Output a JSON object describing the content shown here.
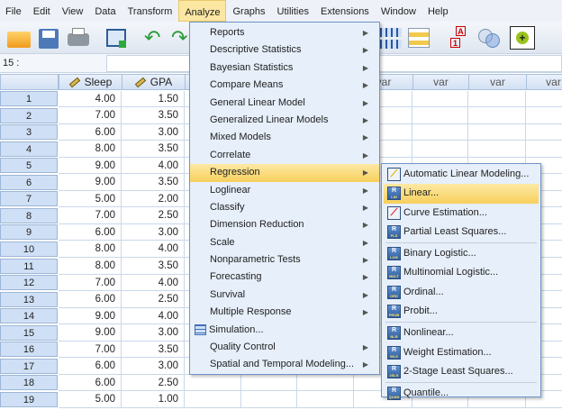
{
  "menubar": [
    "File",
    "Edit",
    "View",
    "Data",
    "Transform",
    "Analyze",
    "Graphs",
    "Utilities",
    "Extensions",
    "Window",
    "Help"
  ],
  "active_menu": "Analyze",
  "cell_ref": "15 :",
  "columns": [
    "Sleep",
    "GPA",
    "var",
    "var",
    "var",
    "var"
  ],
  "rows": [
    [
      "1",
      "4.00",
      "1.50"
    ],
    [
      "2",
      "7.00",
      "3.50"
    ],
    [
      "3",
      "6.00",
      "3.00"
    ],
    [
      "4",
      "8.00",
      "3.50"
    ],
    [
      "5",
      "9.00",
      "4.00"
    ],
    [
      "6",
      "9.00",
      "3.50"
    ],
    [
      "7",
      "5.00",
      "2.00"
    ],
    [
      "8",
      "7.00",
      "2.50"
    ],
    [
      "9",
      "6.00",
      "3.00"
    ],
    [
      "10",
      "8.00",
      "4.00"
    ],
    [
      "11",
      "8.00",
      "3.50"
    ],
    [
      "12",
      "7.00",
      "4.00"
    ],
    [
      "13",
      "6.00",
      "2.50"
    ],
    [
      "14",
      "9.00",
      "4.00"
    ],
    [
      "15",
      "9.00",
      "3.00"
    ],
    [
      "16",
      "7.00",
      "3.50"
    ],
    [
      "17",
      "6.00",
      "3.00"
    ],
    [
      "18",
      "6.00",
      "2.50"
    ],
    [
      "19",
      "5.00",
      "1.00"
    ]
  ],
  "analyze_menu": [
    {
      "label": "Reports",
      "sub": true
    },
    {
      "label": "Descriptive Statistics",
      "sub": true
    },
    {
      "label": "Bayesian Statistics",
      "sub": true
    },
    {
      "label": "Compare Means",
      "sub": true
    },
    {
      "label": "General Linear Model",
      "sub": true
    },
    {
      "label": "Generalized Linear Models",
      "sub": true
    },
    {
      "label": "Mixed Models",
      "sub": true
    },
    {
      "label": "Correlate",
      "sub": true
    },
    {
      "label": "Regression",
      "sub": true,
      "highlighted": true
    },
    {
      "label": "Loglinear",
      "sub": true
    },
    {
      "label": "Classify",
      "sub": true
    },
    {
      "label": "Dimension Reduction",
      "sub": true
    },
    {
      "label": "Scale",
      "sub": true
    },
    {
      "label": "Nonparametric Tests",
      "sub": true
    },
    {
      "label": "Forecasting",
      "sub": true
    },
    {
      "label": "Survival",
      "sub": true
    },
    {
      "label": "Multiple Response",
      "sub": true
    },
    {
      "label": "Simulation...",
      "sub": false,
      "icon": "simulation-icon"
    },
    {
      "label": "Quality Control",
      "sub": true
    },
    {
      "label": "Spatial and Temporal Modeling...",
      "sub": true
    }
  ],
  "regression_menu": [
    {
      "label": "Automatic Linear Modeling...",
      "icon": "auto-linear-icon",
      "tag": ""
    },
    {
      "label": "Linear...",
      "icon": "linear-icon",
      "tag": "LIN",
      "highlighted": true
    },
    {
      "label": "Curve Estimation...",
      "icon": "curve-icon",
      "tag": ""
    },
    {
      "label": "Partial Least Squares...",
      "icon": "pls-icon",
      "tag": "PLS",
      "sep_after": true
    },
    {
      "label": "Binary Logistic...",
      "icon": "logistic-icon",
      "tag": "LOG"
    },
    {
      "label": "Multinomial Logistic...",
      "icon": "multinomial-icon",
      "tag": "MULT"
    },
    {
      "label": "Ordinal...",
      "icon": "ordinal-icon",
      "tag": "ORD"
    },
    {
      "label": "Probit...",
      "icon": "probit-icon",
      "tag": "PROB",
      "sep_after": true
    },
    {
      "label": "Nonlinear...",
      "icon": "nonlinear-icon",
      "tag": "NLR"
    },
    {
      "label": "Weight Estimation...",
      "icon": "weight-icon",
      "tag": "WLS"
    },
    {
      "label": "2-Stage Least Squares...",
      "icon": "2sls-icon",
      "tag": "2SLS",
      "sep_after": true
    },
    {
      "label": "Quantile...",
      "icon": "quantile-icon",
      "tag": "QUAN"
    }
  ],
  "colors": {
    "highlight": "#f7cf5c",
    "menu_bg": "#e6effa",
    "row_header": "#cfe0f6"
  }
}
